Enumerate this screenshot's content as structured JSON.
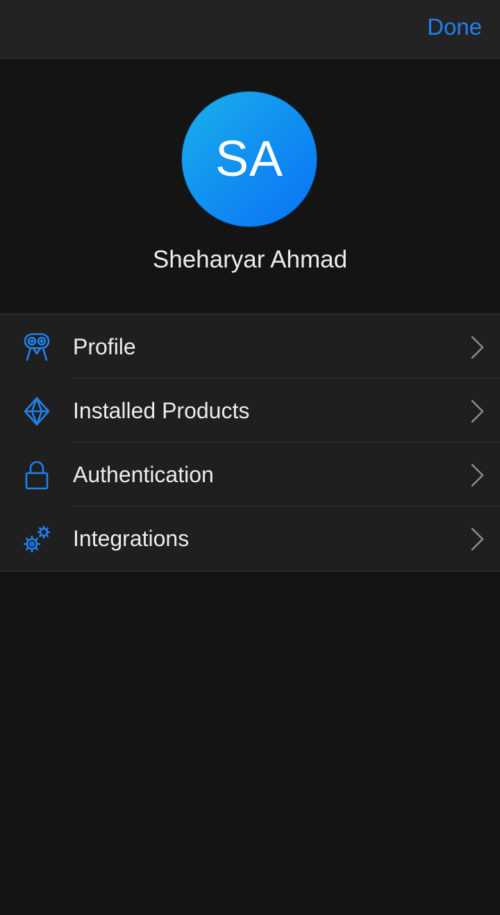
{
  "toolbar": {
    "done_label": "Done"
  },
  "user": {
    "initials": "SA",
    "name": "Sheharyar Ahmad"
  },
  "menu": {
    "items": [
      {
        "label": "Profile",
        "icon": "profile-icon"
      },
      {
        "label": "Installed Products",
        "icon": "diamond-icon"
      },
      {
        "label": "Authentication",
        "icon": "lock-icon"
      },
      {
        "label": "Integrations",
        "icon": "gears-icon"
      }
    ]
  },
  "colors": {
    "accent": "#1f82f0",
    "background": "#141414",
    "list_background": "#1f1f1f",
    "chevron": "#8a8a8a"
  }
}
